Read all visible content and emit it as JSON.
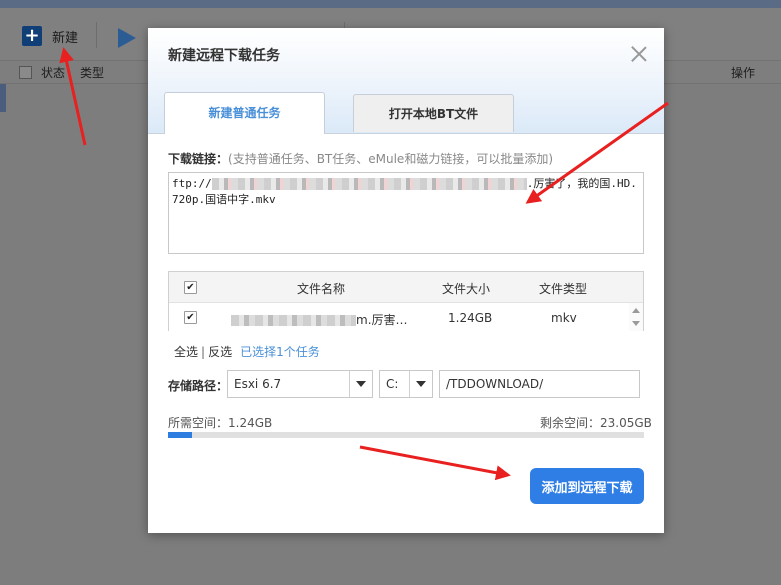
{
  "toolbar": {
    "new_label": "新建"
  },
  "list_header": {
    "status": "状态",
    "type": "类型",
    "action": "操作"
  },
  "dialog": {
    "title": "新建远程下载任务",
    "tabs": [
      {
        "label": "新建普通任务"
      },
      {
        "label": "打开本地BT文件"
      }
    ],
    "link_label": "下载链接：",
    "link_hint": "(支持普通任务、BT任务、eMule和磁力链接，可以批量添加)",
    "link_value_start": "ftp://",
    "link_value_end": ".厉害了，我的国.HD.720p.国语中字.mkv",
    "table": {
      "headers": {
        "name": "文件名称",
        "size": "文件大小",
        "type": "文件类型"
      },
      "rows": [
        {
          "name_suffix": "m.厉害…",
          "size": "1.24GB",
          "type": "mkv"
        }
      ]
    },
    "select_all": "全选",
    "invert": "反选",
    "selected_count": "已选择1个任务",
    "save_path_label": "存储路径：",
    "device": "Esxi 6.7",
    "drive": "C:",
    "path": "/TDDOWNLOAD/",
    "space_needed": "所需空间：1.24GB",
    "space_free": "剩余空间：23.05GB",
    "space_used_fraction": 0.05,
    "submit": "添加到远程下载"
  }
}
